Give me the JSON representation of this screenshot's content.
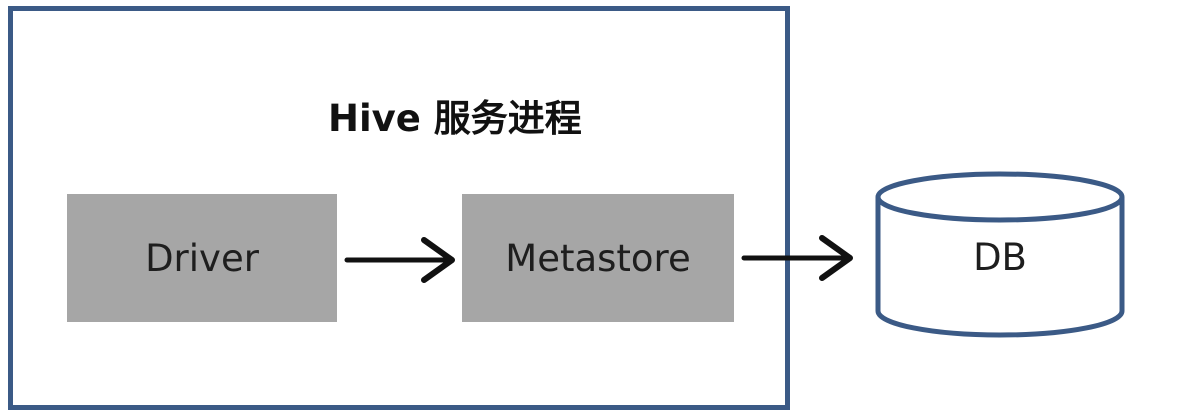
{
  "diagram": {
    "process_title": "Hive 服务进程",
    "components": {
      "driver": "Driver",
      "metastore": "Metastore"
    },
    "database": "DB"
  },
  "colors": {
    "process_border": "#3b5a86",
    "component_fill": "#a6a6a6",
    "database_stroke": "#3b5a86",
    "arrow": "#111111"
  }
}
